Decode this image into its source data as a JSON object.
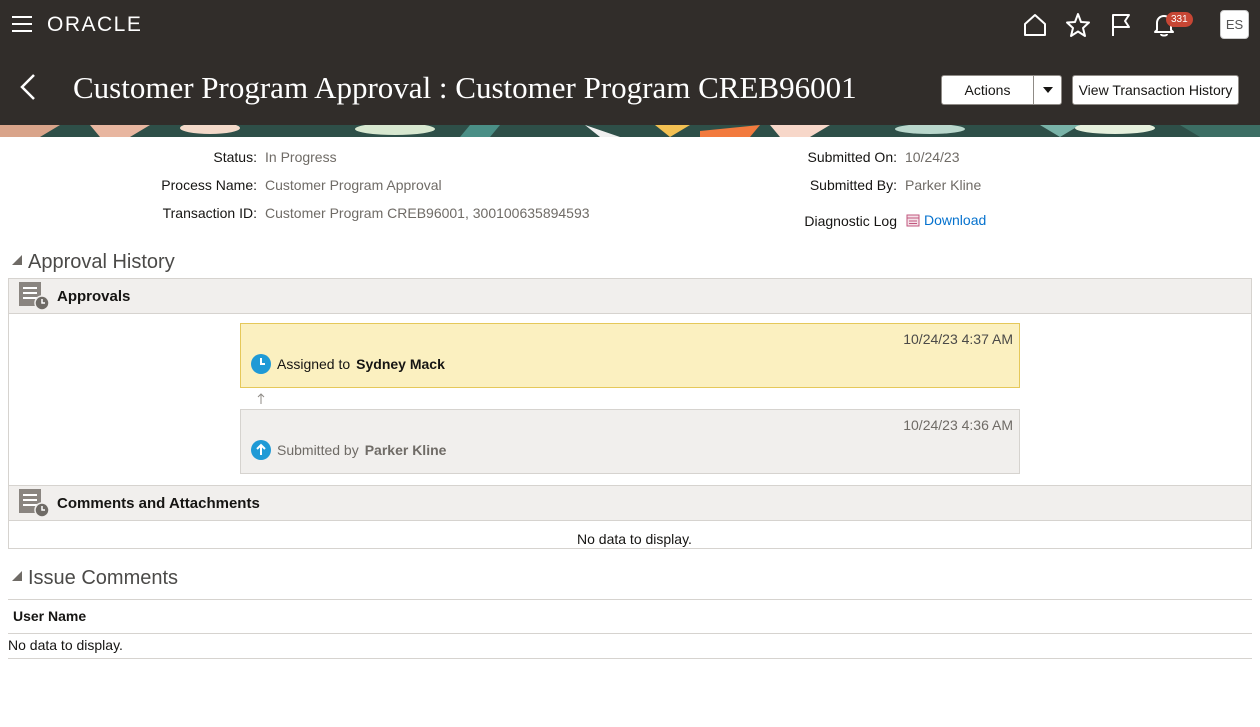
{
  "header": {
    "brand": "ORACLE",
    "notification_count": "331",
    "user_initials": "ES"
  },
  "title_bar": {
    "title": "Customer Program Approval : Customer Program CREB96001",
    "actions_label": "Actions",
    "history_label": "View Transaction History"
  },
  "info": {
    "status_label": "Status:",
    "status_value": "In Progress",
    "process_label": "Process Name:",
    "process_value": "Customer Program Approval",
    "txn_label": "Transaction ID:",
    "txn_value": "Customer Program CREB96001, 300100635894593",
    "submitted_on_label": "Submitted On:",
    "submitted_on_value": "10/24/23",
    "submitted_by_label": "Submitted By:",
    "submitted_by_value": "Parker Kline",
    "diag_label": "Diagnostic Log",
    "download_label": "Download"
  },
  "approval_history": {
    "title": "Approval History",
    "approvals_title": "Approvals",
    "entries": [
      {
        "timestamp": "10/24/23 4:37 AM",
        "prefix": "Assigned to",
        "name": "Sydney Mack"
      },
      {
        "timestamp": "10/24/23 4:36 AM",
        "prefix": "Submitted by",
        "name": "Parker Kline"
      }
    ],
    "comments_title": "Comments and Attachments",
    "comments_empty": "No data to display."
  },
  "issue_comments": {
    "title": "Issue Comments",
    "column_user_name": "User Name",
    "empty": "No data to display."
  },
  "colors": {
    "header_bg": "#312d2a",
    "pending_card_bg": "#fbf0c0",
    "pending_card_border": "#e5c85a",
    "done_card_bg": "#f1efed",
    "status_icon": "#1f9ad6",
    "link": "#0572ce",
    "badge": "#c74634"
  }
}
